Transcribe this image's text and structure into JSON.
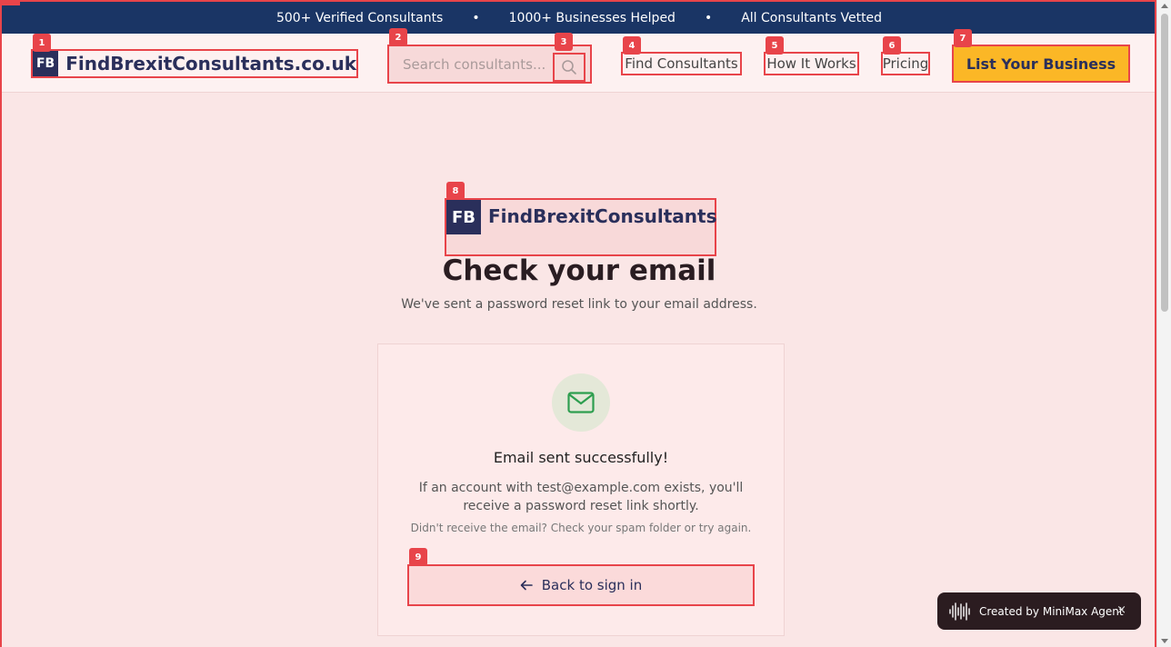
{
  "topbar": {
    "item1": "500+ Verified Consultants",
    "item2": "1000+ Businesses Helped",
    "item3": "All Consultants Vetted",
    "separator": "•"
  },
  "header": {
    "logo_initials": "FB",
    "brand_name": "FindBrexitConsultants.co.uk",
    "search_placeholder": "Search consultants...",
    "nav": {
      "find": "Find Consultants",
      "how": "How It Works",
      "pricing": "Pricing"
    },
    "cta": "List Your Business"
  },
  "badges": {
    "b1": "1",
    "b2": "2",
    "b3": "3",
    "b4": "4",
    "b5": "5",
    "b6": "6",
    "b7": "7",
    "b8": "8",
    "b9": "9"
  },
  "main": {
    "logo_initials": "FB",
    "logo_name": "FindBrexitConsultants",
    "title": "Check your email",
    "subtitle": "We've sent a password reset link to your email address."
  },
  "card": {
    "icon": "mail-icon",
    "title": "Email sent successfully!",
    "text": "If an account with test@example.com exists, you'll receive a password reset link shortly.",
    "note": "Didn't receive the email? Check your spam folder or try again.",
    "back_label": "Back to sign in"
  },
  "toast": {
    "label": "Created by MiniMax Agent",
    "close": "×"
  },
  "colors": {
    "navy": "#1a3565",
    "brand": "#2a2f5b",
    "accent": "#fbb726",
    "highlight": "#e8444a",
    "success": "#2e9e4f"
  }
}
